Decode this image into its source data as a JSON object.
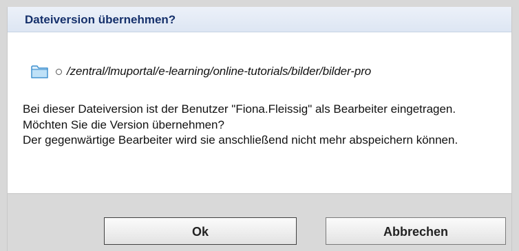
{
  "dialog": {
    "title": "Dateiversion übernehmen?",
    "path": "/zentral/lmuportal/e-learning/online-tutorials/bilder/bilder-pro",
    "folder_icon": "folder-icon",
    "bullet_icon": "circle-bullet-icon",
    "message_1": "Bei dieser Dateiversion ist der Benutzer \"Fiona.Fleissig\" als Bearbeiter eingetragen. Möchten Sie die Version übernehmen?",
    "message_2": "Der gegenwärtige Bearbeiter wird sie anschließend nicht mehr abspeichern können."
  },
  "buttons": {
    "ok_label": "Ok",
    "cancel_label": "Abbrechen"
  },
  "colors": {
    "title_text": "#15306b",
    "title_bar": "#e4ebf6",
    "footer": "#d9d9d9",
    "folder": "#5aa7de"
  }
}
